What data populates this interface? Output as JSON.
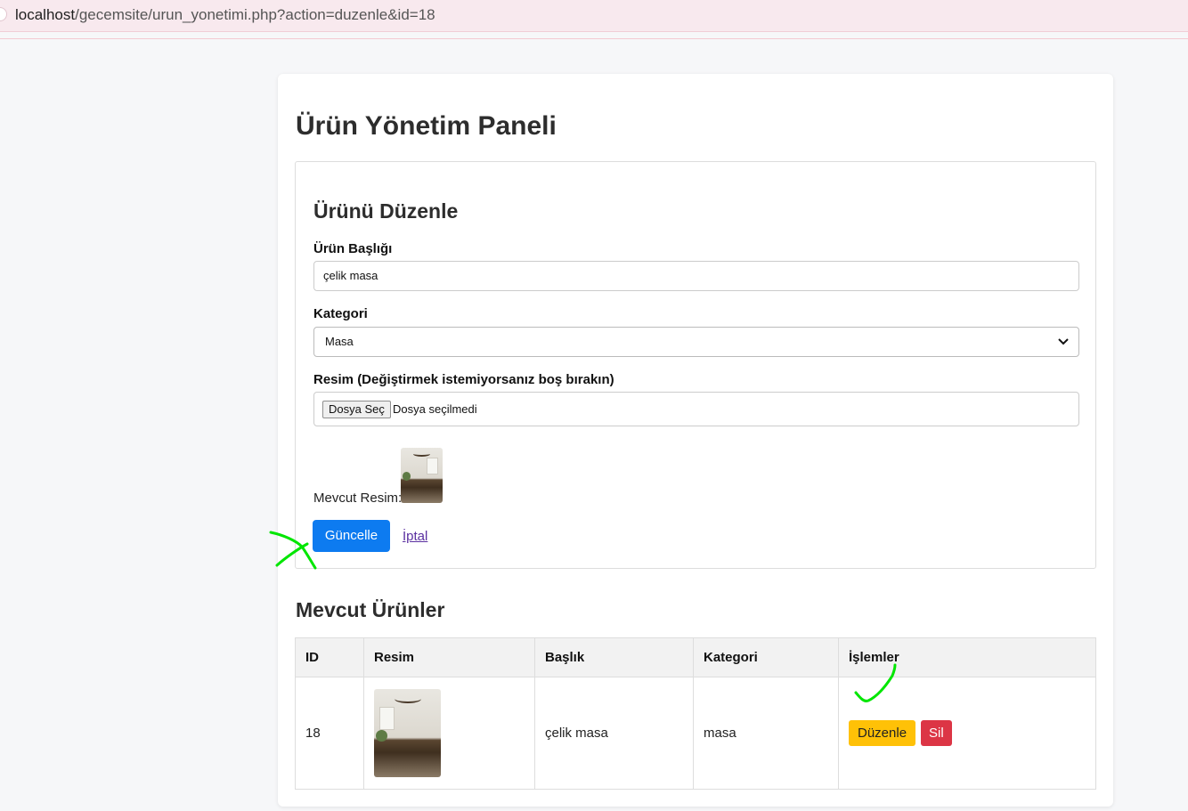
{
  "browser": {
    "url_host": "localhost",
    "url_path": "/gecemsite/urun_yonetimi.php?action=duzenle&id=18"
  },
  "page": {
    "title": "Ürün Yönetim Paneli"
  },
  "edit_form": {
    "title": "Ürünü Düzenle",
    "title_label": "Ürün Başlığı",
    "title_value": "çelik masa",
    "category_label": "Kategori",
    "category_value": "Masa",
    "image_label": "Resim (Değiştirmek istemiyorsanız boş bırakın)",
    "file_button": "Dosya Seç",
    "file_status": "Dosya seçilmedi",
    "current_image_label": "Mevcut Resim:",
    "update_button": "Güncelle",
    "cancel_link": "İptal"
  },
  "products": {
    "title": "Mevcut Ürünler",
    "columns": [
      "ID",
      "Resim",
      "Başlık",
      "Kategori",
      "İşlemler"
    ],
    "rows": [
      {
        "id": "18",
        "title": "çelik masa",
        "category": "masa",
        "edit": "Düzenle",
        "delete": "Sil"
      }
    ]
  },
  "colors": {
    "primary": "#0d7bf0",
    "warning": "#ffc107",
    "danger": "#dc3545",
    "annotation": "#00e600"
  }
}
